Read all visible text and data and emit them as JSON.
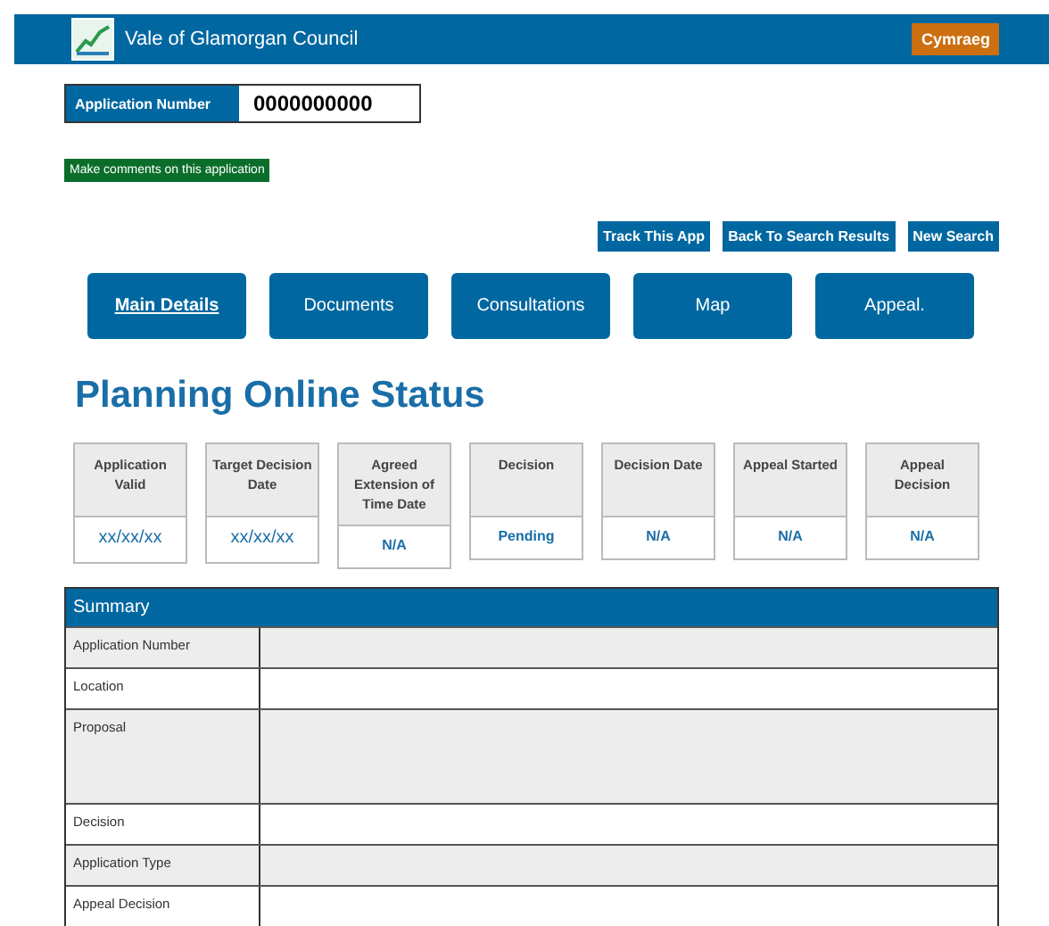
{
  "header": {
    "title": "Vale of Glamorgan Council",
    "language_button": "Cymraeg"
  },
  "application_number": {
    "label": "Application Number",
    "value": "0000000000"
  },
  "comment_button": "Make comments on this application",
  "actions": [
    "Track This App",
    "Back To Search Results",
    "New Search"
  ],
  "tabs": [
    {
      "label": "Main Details",
      "selected": true
    },
    {
      "label": "Documents",
      "selected": false
    },
    {
      "label": "Consultations",
      "selected": false
    },
    {
      "label": "Map",
      "selected": false
    },
    {
      "label": "Appeal.",
      "selected": false
    }
  ],
  "heading": "Planning Online Status",
  "status": [
    {
      "label": "Application Valid",
      "value": "xx/xx/xx",
      "bold": false
    },
    {
      "label": "Target Decision Date",
      "value": "xx/xx/xx",
      "bold": false
    },
    {
      "label": "Agreed Extension of Time Date",
      "value": "N/A",
      "bold": true
    },
    {
      "label": "Decision",
      "value": "Pending",
      "bold": true
    },
    {
      "label": "Decision Date",
      "value": "N/A",
      "bold": true
    },
    {
      "label": "Appeal Started",
      "value": "N/A",
      "bold": true
    },
    {
      "label": "Appeal Decision",
      "value": "N/A",
      "bold": true
    }
  ],
  "summary": {
    "title": "Summary",
    "rows": [
      {
        "label": "Application Number",
        "tall": false
      },
      {
        "label": "Location",
        "tall": false
      },
      {
        "label": "Proposal",
        "tall": true
      },
      {
        "label": "Decision",
        "tall": false
      },
      {
        "label": "Application Type",
        "tall": false
      },
      {
        "label": "Appeal Decision",
        "tall": false
      }
    ]
  }
}
